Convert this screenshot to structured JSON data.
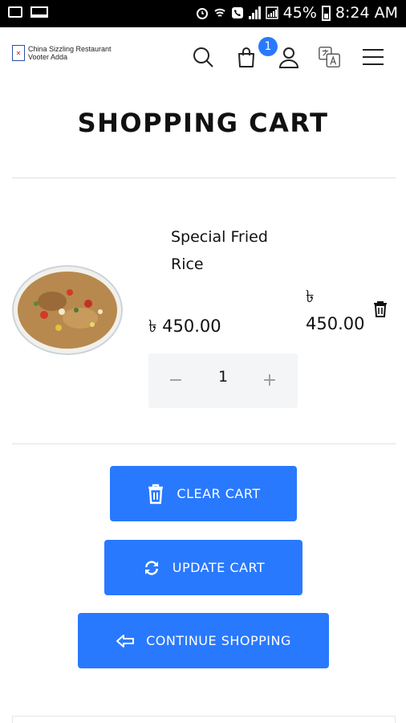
{
  "status_bar": {
    "battery": "45%",
    "time": "8:24 AM"
  },
  "header": {
    "logo_line1": "China Sizzling Restaurant",
    "logo_line2": "Vooter Adda",
    "cart_count": "1",
    "icons": [
      "search-icon",
      "cart-bag-icon",
      "user-icon",
      "translate-icon",
      "menu-icon"
    ]
  },
  "page": {
    "title": "SHOPPING CART"
  },
  "cart": {
    "items": [
      {
        "name": "Special Fried Rice",
        "unit_price": "৳ 450.00",
        "line_total_symbol": "৳",
        "line_total_value": "450.00",
        "quantity": "1",
        "minus": "−",
        "plus": "+"
      }
    ]
  },
  "actions": {
    "clear": "CLEAR CART",
    "update": "UPDATE CART",
    "continue": "CONTINUE SHOPPING"
  },
  "colors": {
    "accent": "#2979ff",
    "qty_bg": "#f4f5f6"
  }
}
